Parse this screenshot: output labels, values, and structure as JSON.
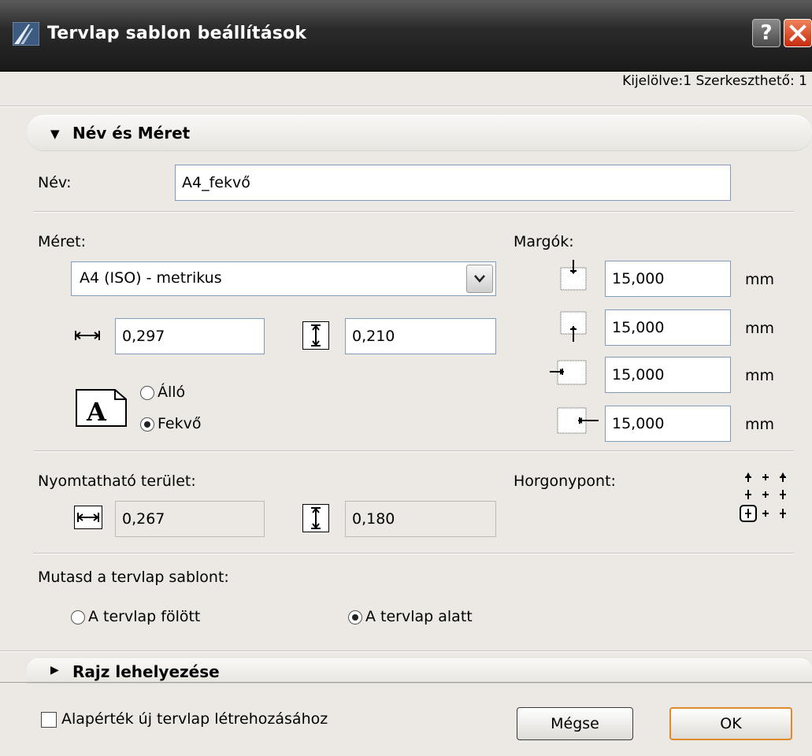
{
  "window": {
    "title": "Tervlap sablon beállítások",
    "help_label": "?",
    "close_icon": "close-icon"
  },
  "status": {
    "text": "Kijelölve:1 Szerkeszthető: 1"
  },
  "panel1": {
    "title": "Név és Méret",
    "name_label": "Név:",
    "name_value": "A4_fekvő",
    "size_label": "Méret:",
    "size_selected": "A4 (ISO) - metrikus",
    "width_value": "0,297",
    "height_value": "0,210",
    "orientation": {
      "portrait_label": "Álló",
      "landscape_label": "Fekvő",
      "selected": "landscape",
      "icon_letter": "A"
    },
    "margins_label": "Margók:",
    "margins": [
      {
        "value": "15,000",
        "unit": "mm"
      },
      {
        "value": "15,000",
        "unit": "mm"
      },
      {
        "value": "15,000",
        "unit": "mm"
      },
      {
        "value": "15,000",
        "unit": "mm"
      }
    ],
    "printable_label": "Nyomtatható terület:",
    "printable_width": "0,267",
    "printable_height": "0,180",
    "anchor_label": "Horgonypont:",
    "anchor_selected": "bottom-left",
    "show_label": "Mutasd a tervlap sablont:",
    "show_above_label": "A tervlap fölött",
    "show_below_label": "A tervlap alatt",
    "show_selected": "below"
  },
  "panel2": {
    "title": "Rajz lehelyezése"
  },
  "footer": {
    "default_checkbox_label": "Alapérték új tervlap létrehozásához",
    "default_checked": false,
    "cancel_label": "Mégse",
    "ok_label": "OK"
  },
  "colors": {
    "title_bar": "#2b2b2b",
    "close_button": "#d4401e",
    "default_button_border": "#e08a2c"
  }
}
